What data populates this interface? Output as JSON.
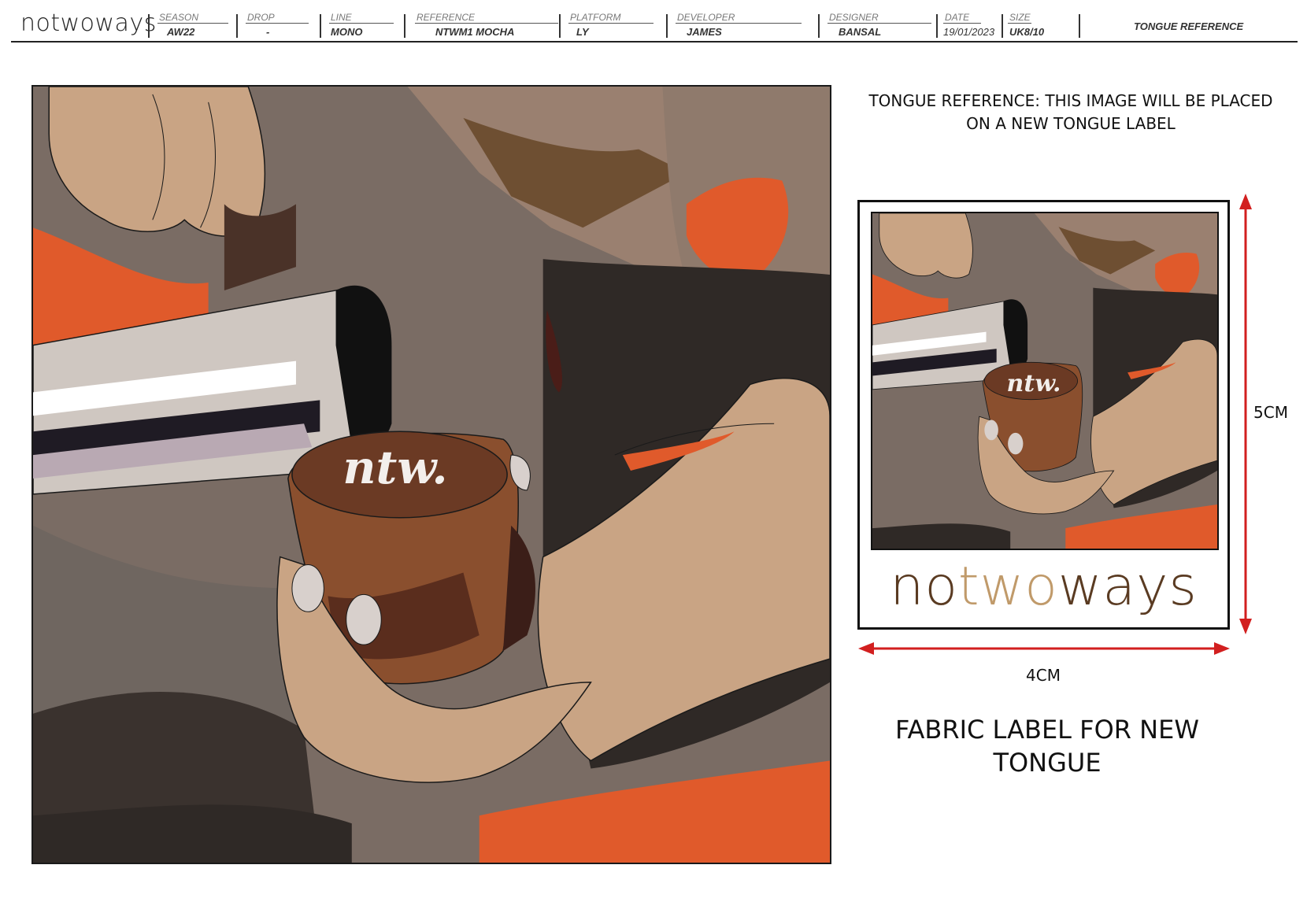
{
  "header": {
    "brand": "notwoways",
    "fields": [
      {
        "label": "SEASON",
        "value": "AW22"
      },
      {
        "label": "DROP",
        "value": "-"
      },
      {
        "label": "LINE",
        "value": "MONO"
      },
      {
        "label": "REFERENCE",
        "value": "NTWM1 MOCHA"
      },
      {
        "label": "PLATFORM",
        "value": "LY"
      },
      {
        "label": "DEVELOPER",
        "value": "JAMES"
      },
      {
        "label": "DESIGNER",
        "value": "BANSAL"
      },
      {
        "label": "DATE",
        "value": "19/01/2023"
      },
      {
        "label": "SIZE",
        "value": "UK8/10"
      }
    ],
    "page_title": "TONGUE REFERENCE"
  },
  "artwork": {
    "logo_text": "ntw."
  },
  "note": {
    "line1": "TONGUE REFERENCE: THIS IMAGE WILL BE PLACED",
    "line2": "ON A NEW TONGUE LABEL"
  },
  "label": {
    "brand_parts": [
      "no",
      "two",
      "ways"
    ],
    "brand_colors": [
      "#5a3b22",
      "#c09a6a",
      "#5a3b22"
    ],
    "logo_text": "ntw.",
    "width_dimension": "4CM",
    "height_dimension": "5CM"
  },
  "caption": {
    "line1": "FABRIC LABEL FOR NEW",
    "line2": "TONGUE"
  },
  "colors": {
    "accent_orange": "#e05a2b",
    "dimension_arrow": "#d21f1f",
    "skin": "#c9a484",
    "shadow_dark": "#2f2926",
    "pitcher_silver": "#cfc7c1"
  }
}
